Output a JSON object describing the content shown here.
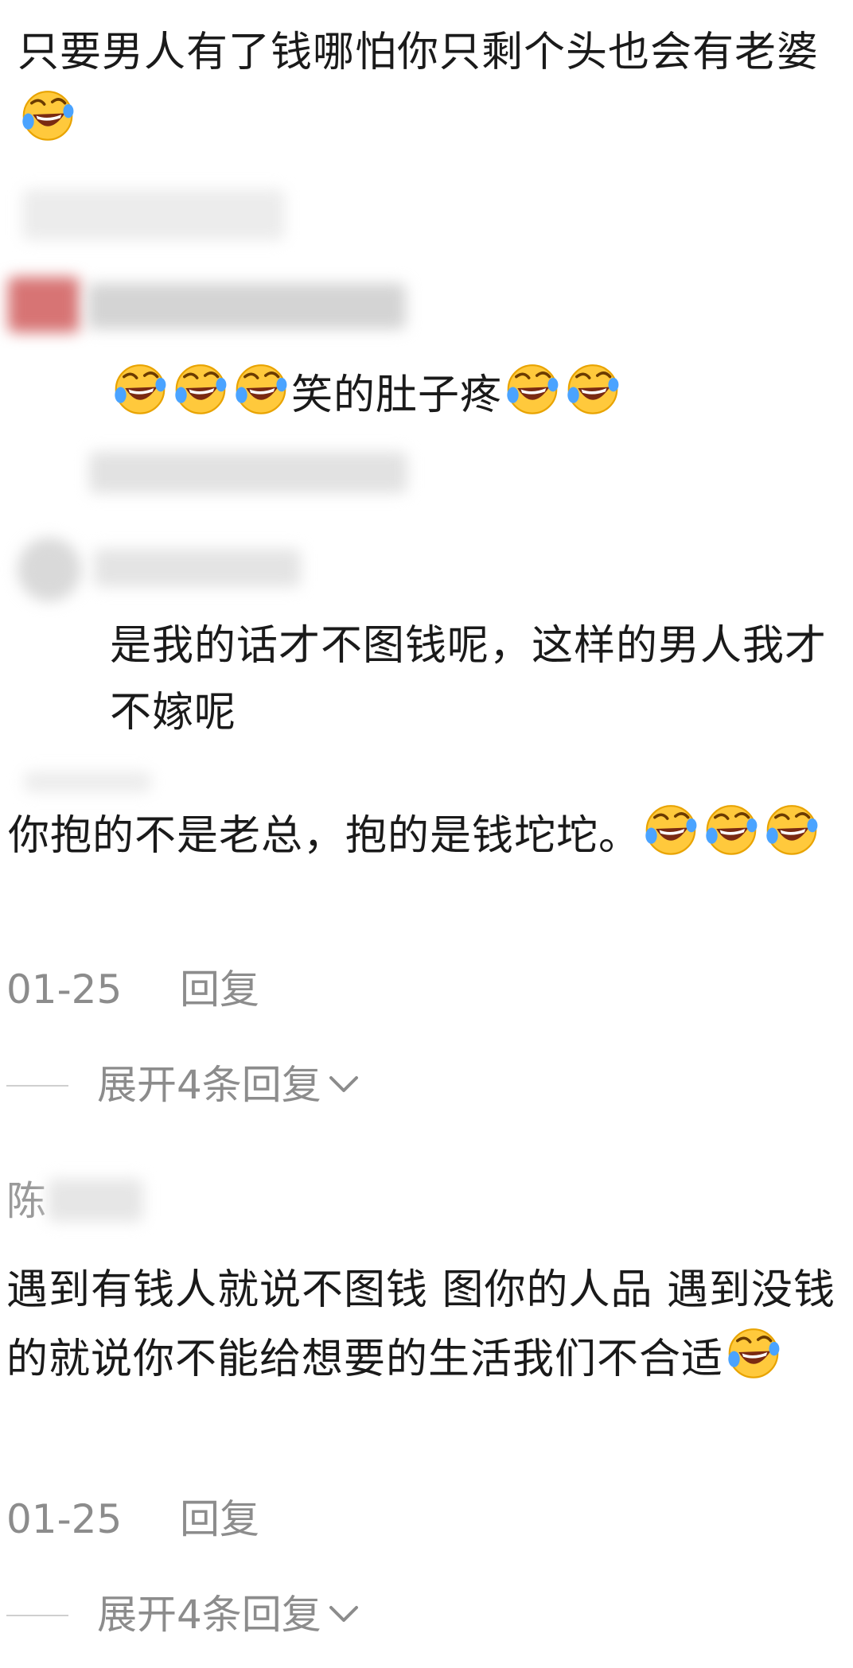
{
  "comments": {
    "c1_text": "只要男人有了钱哪怕你只剩个头也会有老婆",
    "reply1_text": "笑的肚子疼",
    "reply2_text": "是我的话才不图钱呢，这样的男人我才不嫁呢",
    "c2_text": "你抱的不是老总，抱的是钱坨坨。",
    "c2_date": "01-25",
    "c2_reply_btn": "回复",
    "c2_expand": "展开4条回复",
    "c3_name_fragment": "陈",
    "c3_text": "遇到有钱人就说不图钱 图你的人品 遇到没钱的就说你不能给想要的生活我们不合适",
    "c3_date": "01-25",
    "c3_reply_btn": "回复",
    "c3_expand": "展开4条回复"
  },
  "icons": {
    "emoji": "rofl-laughing-crying-emoji",
    "chevron": "chevron-down-icon"
  },
  "colors": {
    "text": "#1a1a1a",
    "meta": "#8c8c8c",
    "emoji_face": "#ffc93c",
    "emoji_tear": "#4aa3ff"
  }
}
